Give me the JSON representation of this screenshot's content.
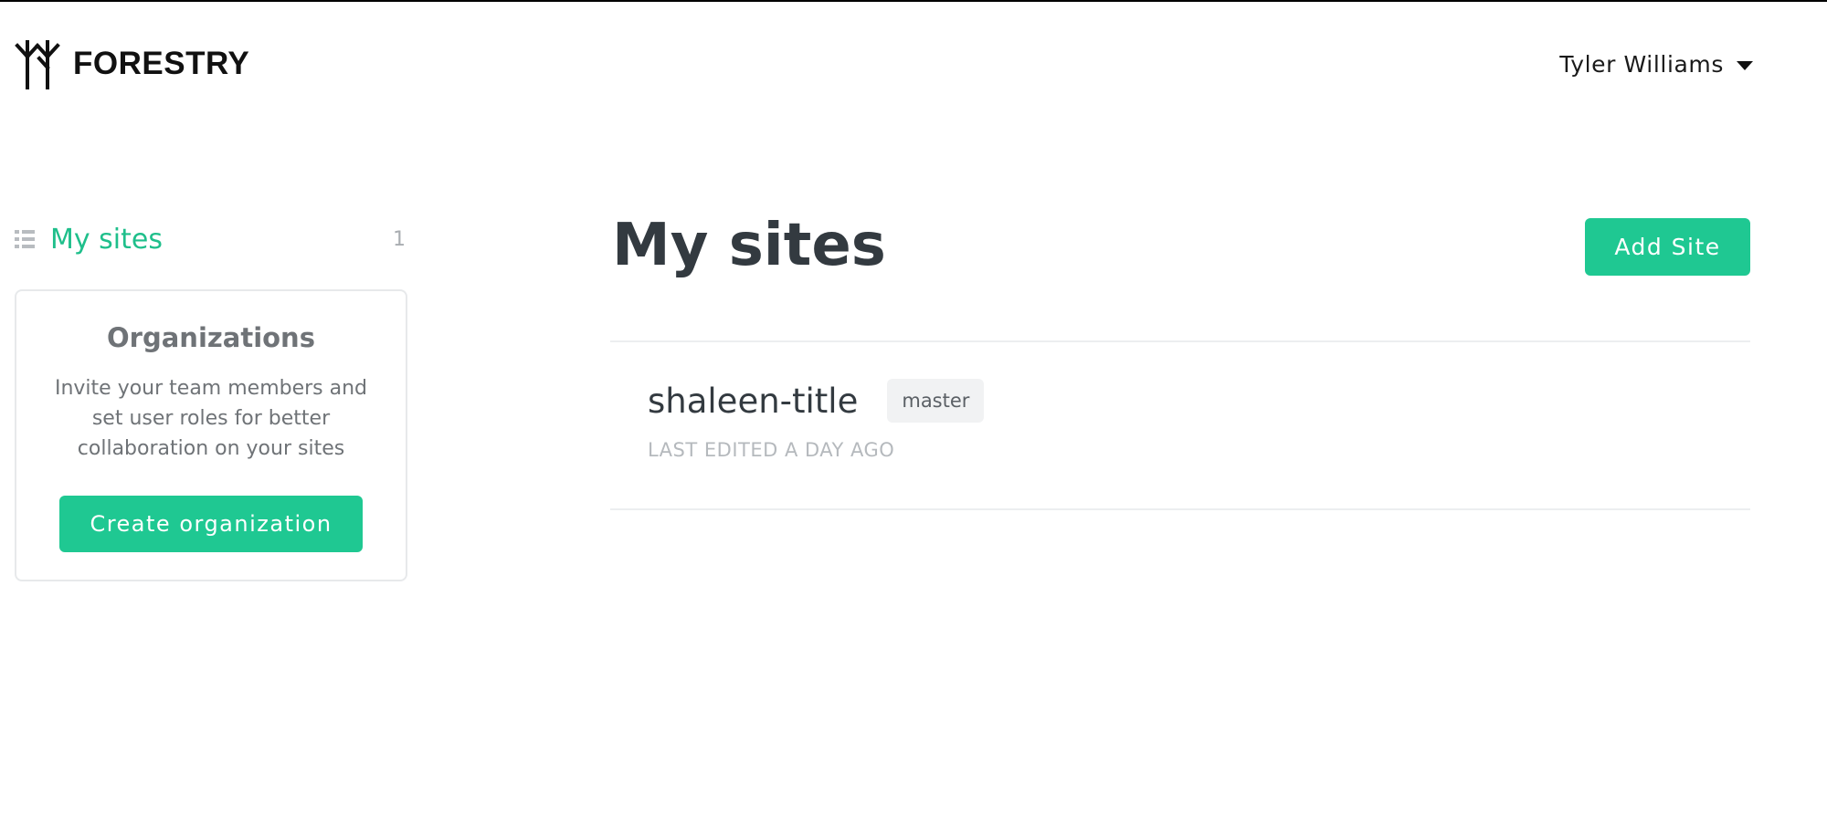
{
  "brand": {
    "name": "FORESTRY"
  },
  "user": {
    "name": "Tyler Williams"
  },
  "sidebar": {
    "nav": {
      "label": "My sites",
      "count": "1"
    },
    "org_card": {
      "title": "Organizations",
      "description": "Invite your team members and set user roles for better collaboration on your sites",
      "button_label": "Create organization"
    }
  },
  "main": {
    "title": "My sites",
    "add_button_label": "Add Site",
    "sites": [
      {
        "name": "shaleen-title",
        "branch": "master",
        "meta": "LAST EDITED A DAY AGO"
      }
    ]
  },
  "colors": {
    "accent": "#1fc892",
    "nav_active": "#1fbf8b",
    "text": "#333a40",
    "muted": "#b5b9bd"
  },
  "icons": {
    "logo": "forestry-tree-icon",
    "user_menu": "caret-down-icon",
    "nav": "list-icon"
  }
}
